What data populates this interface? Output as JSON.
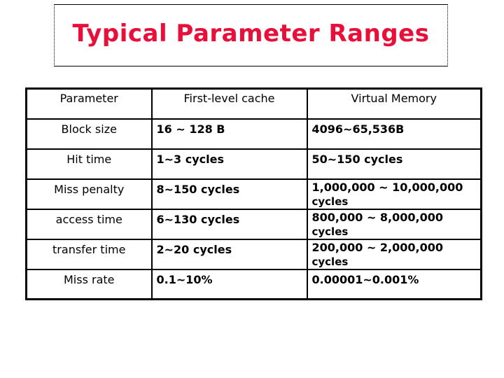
{
  "title": "Typical Parameter Ranges",
  "colors": {
    "title": "#e8103a",
    "text": "#000000",
    "border": "#000000"
  },
  "table": {
    "headers": [
      "Parameter",
      "First-level cache",
      "Virtual Memory"
    ],
    "rows": [
      {
        "parameter": "Block size",
        "cache": "16 ~ 128 B",
        "vm": "4096~65,536B",
        "vm_line2": ""
      },
      {
        "parameter": "Hit time",
        "cache": "1~3 cycles",
        "vm": "50~150 cycles",
        "vm_line2": ""
      },
      {
        "parameter": "Miss penalty",
        "cache": "8~150 cycles",
        "vm": "1,000,000 ~ 10,000,000",
        "vm_line2": "cycles"
      },
      {
        "parameter": "access time",
        "cache": "6~130 cycles",
        "vm": "800,000 ~ 8,000,000",
        "vm_line2": "cycles"
      },
      {
        "parameter": "transfer time",
        "cache": "2~20 cycles",
        "vm": "200,000 ~ 2,000,000",
        "vm_line2": "cycles"
      },
      {
        "parameter": "Miss rate",
        "cache": "0.1~10%",
        "vm": "0.00001~0.001%",
        "vm_line2": ""
      }
    ]
  }
}
